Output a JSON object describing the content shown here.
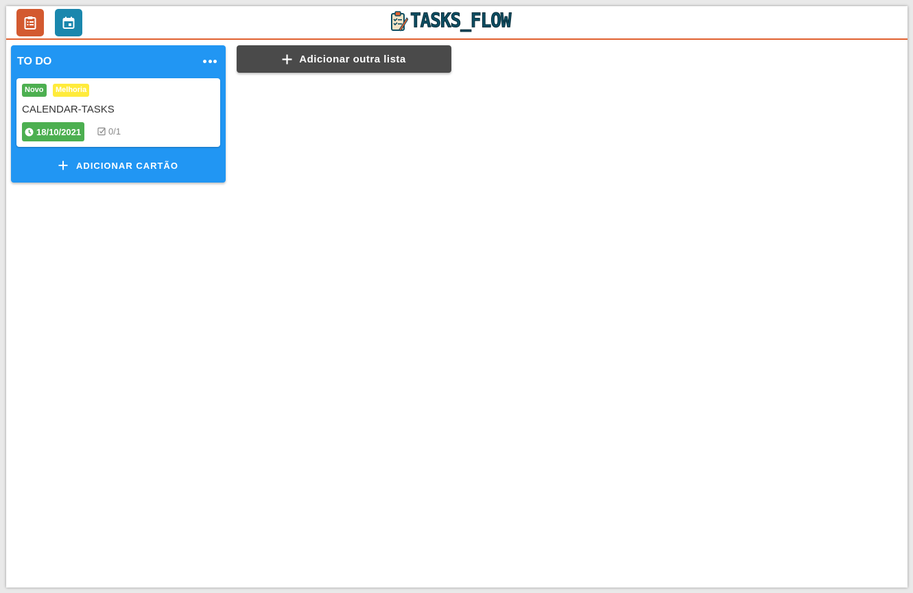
{
  "header": {
    "logo_text": "TASKS_FLOW",
    "nav": [
      {
        "icon": "clipboard-list-icon",
        "color": "#d35a30"
      },
      {
        "icon": "calendar-icon",
        "color": "#1a87ad"
      }
    ],
    "accent_color": "#e0602f"
  },
  "lists": [
    {
      "title": "TO DO",
      "color": "#2196f3",
      "cards": [
        {
          "tags": [
            {
              "label": "Novo",
              "color": "#4caf50"
            },
            {
              "label": "Melhoria",
              "color": "#ffeb3b"
            }
          ],
          "title": "CALENDAR-TASKS",
          "due_date": "18/10/2021",
          "due_color": "#4caf50",
          "checklist": "0/1"
        }
      ],
      "add_card_label": "ADICIONAR CARTÃO"
    }
  ],
  "add_list_label": "Adicionar outra lista"
}
